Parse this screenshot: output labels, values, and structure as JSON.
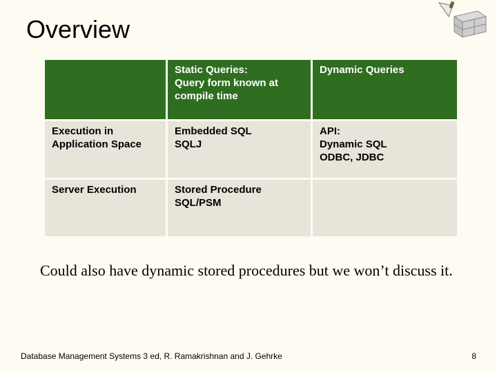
{
  "title": "Overview",
  "chart_data": {
    "type": "table",
    "columns": [
      "",
      "Static Queries:\nQuery form known at compile time",
      "Dynamic Queries"
    ],
    "rows": [
      [
        "Execution in Application Space",
        "Embedded SQL\nSQLJ",
        "API:\nDynamic SQL\nODBC, JDBC"
      ],
      [
        "Server Execution",
        "Stored Procedure\nSQL/PSM",
        ""
      ]
    ]
  },
  "table": {
    "header": {
      "col0": "",
      "col1_line1": "Static Queries:",
      "col1_line2": "Query form known at",
      "col1_line3": "compile time",
      "col2": "Dynamic Queries"
    },
    "row1": {
      "col0_line1": "Execution in",
      "col0_line2": "Application Space",
      "col1_line1": "Embedded SQL",
      "col1_line2": "SQLJ",
      "col2_line1": "API:",
      "col2_line2": "Dynamic SQL",
      "col2_line3": "ODBC, JDBC"
    },
    "row2": {
      "col0": "Server Execution",
      "col1_line1": "Stored Procedure",
      "col1_line2": "SQL/PSM",
      "col2": ""
    }
  },
  "note": "Could also have dynamic stored procedures but we won’t discuss it.",
  "footer_left": "Database Management Systems 3 ed,  R. Ramakrishnan and J. Gehrke",
  "footer_right": "8",
  "icon_name": "brick-trowel-icon"
}
